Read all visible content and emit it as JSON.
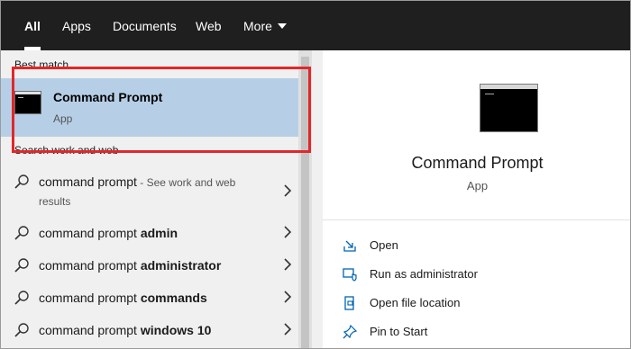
{
  "tabs": [
    {
      "label": "All",
      "active": true
    },
    {
      "label": "Apps",
      "active": false
    },
    {
      "label": "Documents",
      "active": false
    },
    {
      "label": "Web",
      "active": false
    },
    {
      "label": "More",
      "active": false
    }
  ],
  "left": {
    "best_match_header": "Best match",
    "best_match": {
      "title": "Command Prompt",
      "subtitle": "App",
      "icon": "command-prompt-icon"
    },
    "search_web_header": "Search work and web",
    "results": [
      {
        "plain": "command prompt",
        "bold": "",
        "hint": " - See work and web",
        "line2": "results"
      },
      {
        "plain": "command prompt ",
        "bold": "admin",
        "hint": "",
        "line2": ""
      },
      {
        "plain": "command prompt ",
        "bold": "administrator",
        "hint": "",
        "line2": ""
      },
      {
        "plain": "command prompt ",
        "bold": "commands",
        "hint": "",
        "line2": ""
      },
      {
        "plain": "command prompt ",
        "bold": "windows 10",
        "hint": "",
        "line2": ""
      }
    ]
  },
  "right": {
    "app_name": "Command Prompt",
    "app_type": "App",
    "actions": [
      {
        "label": "Open",
        "icon": "open-icon"
      },
      {
        "label": "Run as administrator",
        "icon": "run-as-admin-icon"
      },
      {
        "label": "Open file location",
        "icon": "file-location-icon"
      },
      {
        "label": "Pin to Start",
        "icon": "pin-icon"
      }
    ]
  },
  "colors": {
    "topbar": "#1f1f1f",
    "selection": "#b6cfe6",
    "highlight_box": "#e3262b",
    "accent": "#0063b1"
  }
}
